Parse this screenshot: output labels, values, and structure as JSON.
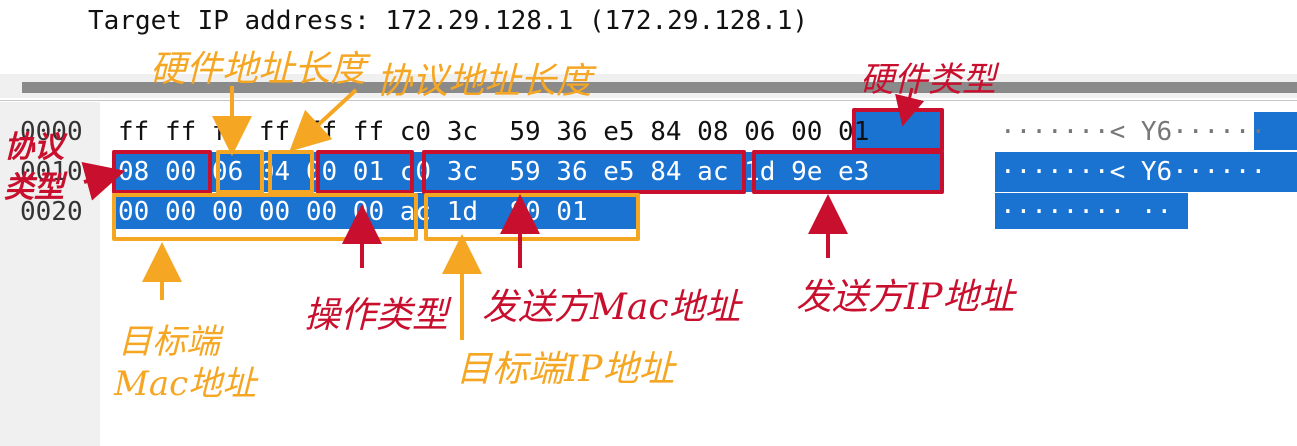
{
  "details": {
    "target_ip_line": "Target IP address: 172.29.128.1 (172.29.128.1)"
  },
  "hex": {
    "rows": [
      {
        "offset": "0000",
        "bytes": "ff ff ff ff ff ff c0 3c  59 36 e5 84 08 06 00 01",
        "ascii": "·······< Y6······"
      },
      {
        "offset": "0010",
        "bytes": "08 00 06 04 00 01 c0 3c  59 36 e5 84 ac 1d 9e e3",
        "ascii": "·······< Y6······"
      },
      {
        "offset": "0020",
        "bytes": "00 00 00 00 00 00 ac 1d  80 01",
        "ascii": "········ ··"
      }
    ]
  },
  "annotations": {
    "hardware_type": "硬件类型",
    "hardware_addr_len": "硬件地址长度",
    "protocol_addr_len": "协议地址长度",
    "protocol_type": "协议类型",
    "opcode": "操作类型",
    "sender_mac": "发送方Mac地址",
    "sender_ip": "发送方IP地址",
    "target_mac_line1": "目标端",
    "target_mac_line2": "Mac地址",
    "target_ip": "目标端IP地址"
  },
  "colors": {
    "selection": "#1a73d1",
    "annotation_red": "#c8102e",
    "annotation_orange": "#f5a623"
  }
}
